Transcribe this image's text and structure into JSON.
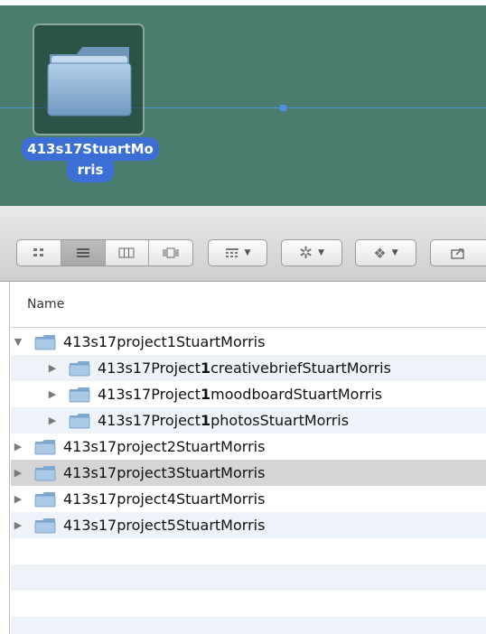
{
  "desktop": {
    "folder_label_line1": "413s17StuartMo",
    "folder_label_line2": "rris"
  },
  "finder": {
    "columns": {
      "name": "Name"
    },
    "rows": [
      {
        "prefix": "413s17project1StuartMorris",
        "bold": "",
        "suffix": "",
        "expanded": true,
        "level": 0,
        "selected": false
      },
      {
        "prefix": "413s17Project",
        "bold": "1",
        "suffix": "creativebriefStuartMorris",
        "expanded": false,
        "level": 1,
        "selected": false
      },
      {
        "prefix": "413s17Project",
        "bold": "1",
        "suffix": "moodboardStuartMorris",
        "expanded": false,
        "level": 1,
        "selected": false
      },
      {
        "prefix": "413s17Project",
        "bold": "1",
        "suffix": "photosStuartMorris",
        "expanded": false,
        "level": 1,
        "selected": false
      },
      {
        "prefix": "413s17project2StuartMorris",
        "bold": "",
        "suffix": "",
        "expanded": false,
        "level": 0,
        "selected": false
      },
      {
        "prefix": "413s17project3StuartMorris",
        "bold": "",
        "suffix": "",
        "expanded": false,
        "level": 0,
        "selected": true
      },
      {
        "prefix": "413s17project4StuartMorris",
        "bold": "",
        "suffix": "",
        "expanded": false,
        "level": 0,
        "selected": false
      },
      {
        "prefix": "413s17project5StuartMorris",
        "bold": "",
        "suffix": "",
        "expanded": false,
        "level": 0,
        "selected": false
      }
    ]
  },
  "toolbar": {
    "view_buttons": [
      "icon-view-icon",
      "list-view-icon",
      "column-view-icon",
      "cover-flow-icon"
    ],
    "arrange_icon": "arrange-icon",
    "action_icon": "gear-icon",
    "dropbox_icon": "dropbox-icon",
    "share_icon": "share-icon"
  },
  "colors": {
    "desktop_bg": "#4a7d6e",
    "selection_blue": "#3b6fd6",
    "guide_line": "#4f8fe0",
    "selected_row": "#d5d5d5",
    "alt_row": "#eef3fa"
  }
}
